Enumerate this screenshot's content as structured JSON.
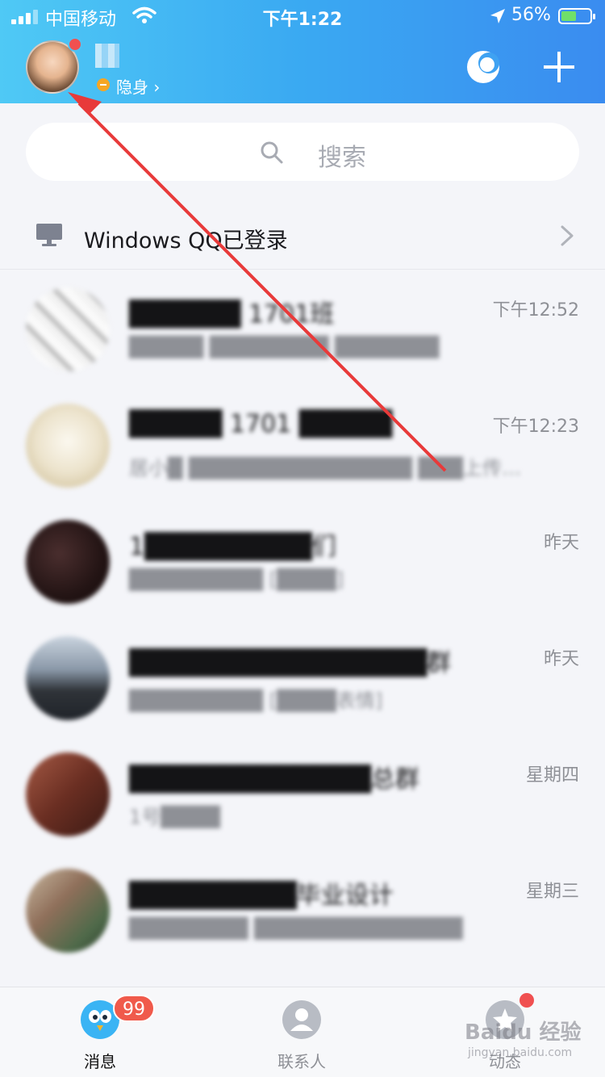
{
  "status_bar": {
    "carrier": "中国移动",
    "time": "下午1:22",
    "battery": "56%"
  },
  "header": {
    "status_label": "隐身 ›"
  },
  "search": {
    "placeholder": "搜索"
  },
  "device_notice": {
    "text": "Windows QQ已登录"
  },
  "chats": [
    {
      "name": "██████ 1701班",
      "preview": "█████ ████████ ███████",
      "time": "下午12:52",
      "avatar_color": "#e8e8e8"
    },
    {
      "name": "█████ 1701 █████",
      "preview": "居小█ ███████████████ ███上传…",
      "time": "下午12:23",
      "avatar_color": "#ece6d6"
    },
    {
      "name": "1█████████们",
      "preview": "█████████ [████]",
      "time": "昨天",
      "avatar_color": "#2a1a1a"
    },
    {
      "name": "████████████████群",
      "preview": "█████████ [████表情]",
      "time": "昨天",
      "avatar_color": "#5b6b7d"
    },
    {
      "name": "█████████████总群",
      "preview": "1号████",
      "time": "星期四",
      "avatar_color": "#7a3a2a"
    },
    {
      "name": "█████████毕业设计",
      "preview": "████████ ██████████████",
      "time": "星期三",
      "avatar_color": "#8a7a6a"
    }
  ],
  "tabs": [
    {
      "label": "消息"
    },
    {
      "label": "联系人"
    },
    {
      "label": "动态"
    }
  ],
  "badge": "99",
  "watermark": {
    "text": "Baidu 经验",
    "sub": "jingyan.baidu.com"
  },
  "colors": {
    "header_start": "#4fc9f5",
    "header_end": "#3a8cf0",
    "badge": "#f05a4b",
    "arrow": "#e83a3a"
  }
}
